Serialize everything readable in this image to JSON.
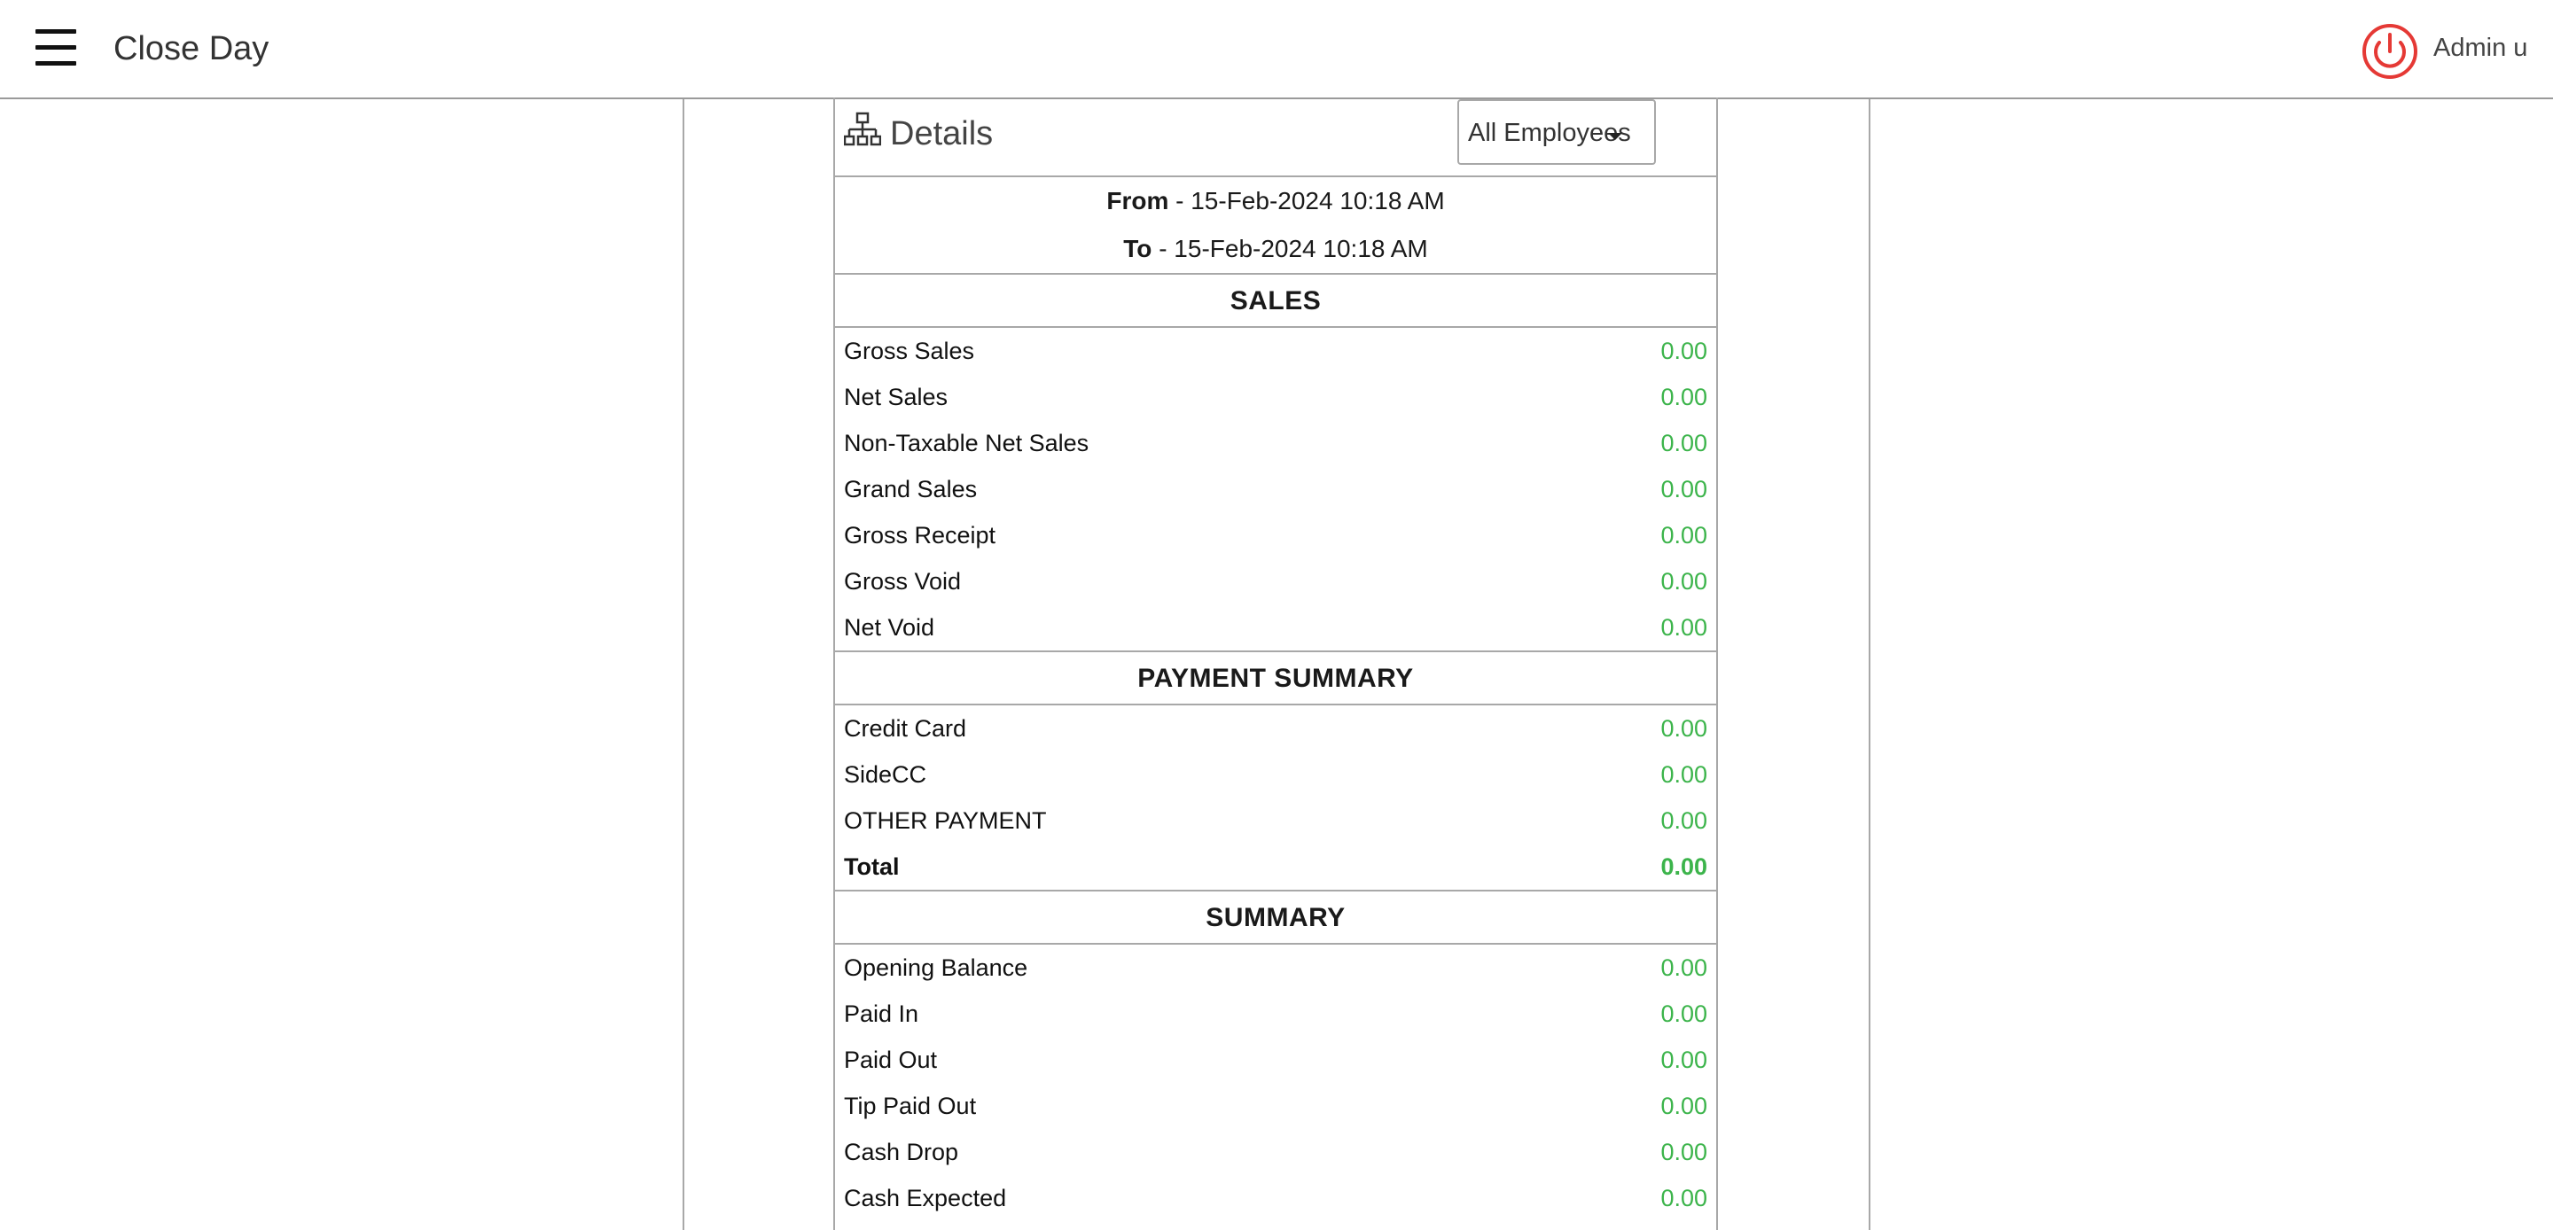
{
  "header": {
    "title": "Close Day",
    "user": "Admin u"
  },
  "details": {
    "title": "Details",
    "employee_filter": {
      "selected": "All Employees"
    },
    "from": {
      "label": "From",
      "value": "15-Feb-2024 10:18 AM"
    },
    "to": {
      "label": "To",
      "value": "15-Feb-2024 10:18 AM"
    }
  },
  "sales": {
    "heading": "SALES",
    "rows": [
      {
        "label": "Gross Sales",
        "value": "0.00"
      },
      {
        "label": "Net Sales",
        "value": "0.00"
      },
      {
        "label": "Non-Taxable Net Sales",
        "value": "0.00"
      },
      {
        "label": "Grand Sales",
        "value": "0.00"
      },
      {
        "label": "Gross Receipt",
        "value": "0.00"
      },
      {
        "label": "Gross Void",
        "value": "0.00"
      },
      {
        "label": "Net Void",
        "value": "0.00"
      }
    ]
  },
  "payment_summary": {
    "heading": "PAYMENT SUMMARY",
    "rows": [
      {
        "label": "Credit Card",
        "value": "0.00"
      },
      {
        "label": "SideCC",
        "value": "0.00"
      },
      {
        "label": "OTHER PAYMENT",
        "value": "0.00"
      },
      {
        "label": "Total",
        "value": "0.00"
      }
    ]
  },
  "summary": {
    "heading": "SUMMARY",
    "rows": [
      {
        "label": "Opening Balance",
        "value": "0.00"
      },
      {
        "label": "Paid In",
        "value": "0.00"
      },
      {
        "label": "Paid Out",
        "value": "0.00"
      },
      {
        "label": "Tip Paid Out",
        "value": "0.00"
      },
      {
        "label": "Cash Drop",
        "value": "0.00"
      },
      {
        "label": "Cash Expected",
        "value": "0.00"
      }
    ]
  },
  "colors": {
    "value_green": "#3cb44b",
    "power_red": "#e53935",
    "border_gray": "#a8a8a8"
  },
  "icons": {
    "menu": "hamburger-icon",
    "power": "power-icon",
    "details": "sitemap-icon",
    "dropdown": "caret-down-icon"
  }
}
